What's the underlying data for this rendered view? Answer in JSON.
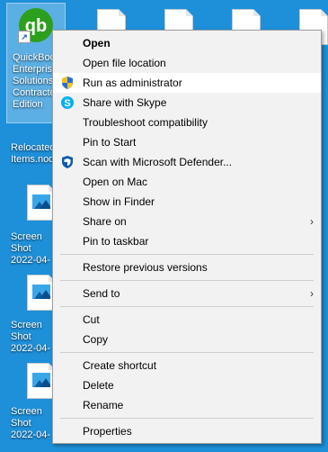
{
  "desktop": {
    "icons": [
      {
        "label": "QuickBooks Enterprise Solutions Contractor Edition"
      },
      {
        "label": "Relocated Items.nod"
      },
      {
        "label": "Screen Shot 2022-04-"
      },
      {
        "label": "Screen Shot 2022-04-"
      },
      {
        "label": "Screen Shot 2022-04-"
      }
    ]
  },
  "menu": {
    "items": [
      {
        "label": "Open"
      },
      {
        "label": "Open file location"
      },
      {
        "label": "Run as administrator"
      },
      {
        "label": "Share with Skype"
      },
      {
        "label": "Troubleshoot compatibility"
      },
      {
        "label": "Pin to Start"
      },
      {
        "label": "Scan with Microsoft Defender..."
      },
      {
        "label": "Open on Mac"
      },
      {
        "label": "Show in Finder"
      },
      {
        "label": "Share on"
      },
      {
        "label": "Pin to taskbar"
      },
      {
        "label": "Restore previous versions"
      },
      {
        "label": "Send to"
      },
      {
        "label": "Cut"
      },
      {
        "label": "Copy"
      },
      {
        "label": "Create shortcut"
      },
      {
        "label": "Delete"
      },
      {
        "label": "Rename"
      },
      {
        "label": "Properties"
      }
    ],
    "submenu_arrow": "›"
  },
  "colors": {
    "desktop": "#1e90d9",
    "menu_bg": "#f2f2f2",
    "quickbooks_green": "#2ca01c",
    "skype_blue": "#00aff0",
    "defender_blue": "#0b5cad"
  }
}
